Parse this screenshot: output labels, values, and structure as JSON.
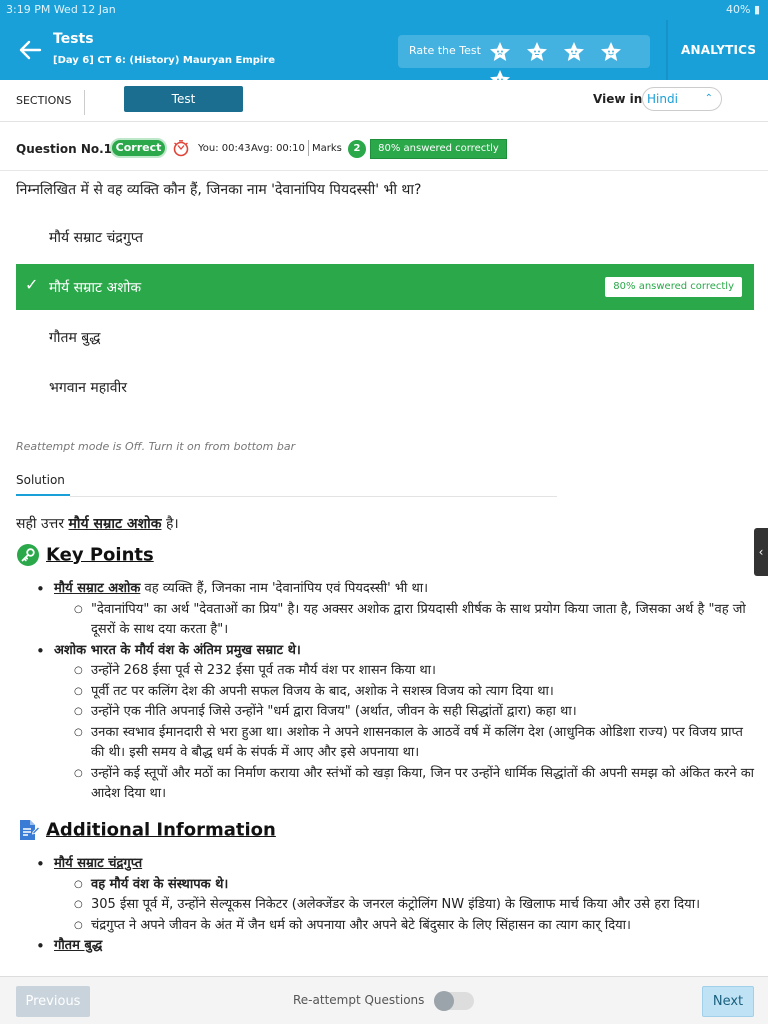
{
  "status_bar": {
    "time": "3:19 PM   Wed 12 Jan",
    "battery": "40% ▮"
  },
  "header": {
    "title": "Tests",
    "subtitle": "[Day 6] CT 6: (History) Mauryan Empire",
    "rate_label": "Rate the Test",
    "star_count": 5,
    "analytics_label": "ANALYTICS"
  },
  "sections_bar": {
    "sections_label": "SECTIONS",
    "active_tab": "Test",
    "view_in_label": "View in",
    "language": "Hindi"
  },
  "question_header": {
    "number": "Question No.1",
    "status": "Correct",
    "you_time": "You: 00:43",
    "avg_time": "Avg: 00:10",
    "marks_label": "Marks",
    "marks_value": "2",
    "percent_correct": "80% answered correctly"
  },
  "question": {
    "text": "निम्नलिखित में से वह व्यक्ति कौन हैं, जिनका नाम 'देवानांपिय पियदस्सी' भी था?",
    "options": [
      {
        "label": "मौर्य सम्राट चंद्रगुप्त",
        "selected": false
      },
      {
        "label": "मौर्य सम्राट अशोक",
        "selected": true,
        "badge": "80% answered correctly"
      },
      {
        "label": "गौतम बुद्ध",
        "selected": false
      },
      {
        "label": "भगवान महावीर",
        "selected": false
      }
    ]
  },
  "reattempt_note": "Reattempt mode is Off. Turn it on from bottom bar",
  "solution": {
    "tab_label": "Solution",
    "answer_prefix": "सही उत्तर",
    "answer": "मौर्य सम्राट अशोक",
    "answer_suffix": "है।",
    "key_points": {
      "heading": "Key Points",
      "b1_bold": "मौर्य सम्राट अशोक",
      "b1_rest": " वह व्यक्ति हैं, जिनका नाम 'देवानांपिय एवं पियदस्सी' भी था।",
      "b1_sub1": "\"देवानांपिय\" का अर्थ \"देवताओं का प्रिय\" है। यह अक्सर अशोक द्वारा प्रियदासी शीर्षक के साथ प्रयोग किया जाता है, जिसका अर्थ है \"वह जो दूसरों के साथ दया करता है\"।",
      "b2_bold": "अशोक भारत के मौर्य वंश के अंतिम प्रमुख सम्राट थे।",
      "b2_sub1": "उन्होंने 268 ईसा पूर्व से 232 ईसा पूर्व तक मौर्य वंश पर शासन किया था।",
      "b2_sub2": "पूर्वी तट पर कलिंग देश की अपनी सफल विजय के बाद, अशोक ने सशस्त्र विजय को त्याग दिया था।",
      "b2_sub3": "उन्होंने एक नीति अपनाई जिसे उन्होंने \"धर्म द्वारा विजय\" (अर्थात, जीवन के सही सिद्धांतों द्वारा) कहा था।",
      "b2_sub4": "उनका स्वभाव ईमानदारी से भरा हुआ था। अशोक ने अपने शासनकाल के आठवें वर्ष में कलिंग देश (आधुनिक ओडिशा राज्य) पर विजय प्राप्त की थी। इसी समय वे बौद्ध धर्म के संपर्क में आए और इसे अपनाया था।",
      "b2_sub5": "उन्होंने कई स्तूपों और मठों का निर्माण कराया और स्तंभों को खड़ा किया, जिन पर उन्होंने धार्मिक सिद्धांतों की अपनी समझ को अंकित करने का आदेश दिया था।"
    },
    "additional_info": {
      "heading": "Additional Information",
      "c1_bold": "मौर्य सम्राट चंद्रगुप्त",
      "c1_sub1": "वह मौर्य वंश के संस्थापक थे।",
      "c1_sub2": "305 ईसा पूर्व में, उन्होंने सेल्यूकस निकेटर (अलेक्जेंडर के जनरल कंट्रोलिंग NW इंडिया) के खिलाफ मार्च किया और उसे हरा दिया।",
      "c1_sub3": "चंद्रगुप्त ने अपने जीवन के अंत में जैन धर्म को अपनाया और अपने बेटे बिंदुसार के लिए सिंहासन का त्याग कार् दिया।",
      "c2_bold": "गौतम बुद्ध"
    }
  },
  "bottom_bar": {
    "previous_label": "Previous",
    "reattempt_label": "Re-attempt Questions",
    "reattempt_on": false,
    "next_label": "Next"
  },
  "colors": {
    "primary": "#1aa0d8",
    "success": "#2aa84a",
    "tab_active": "#1b6e8f"
  }
}
